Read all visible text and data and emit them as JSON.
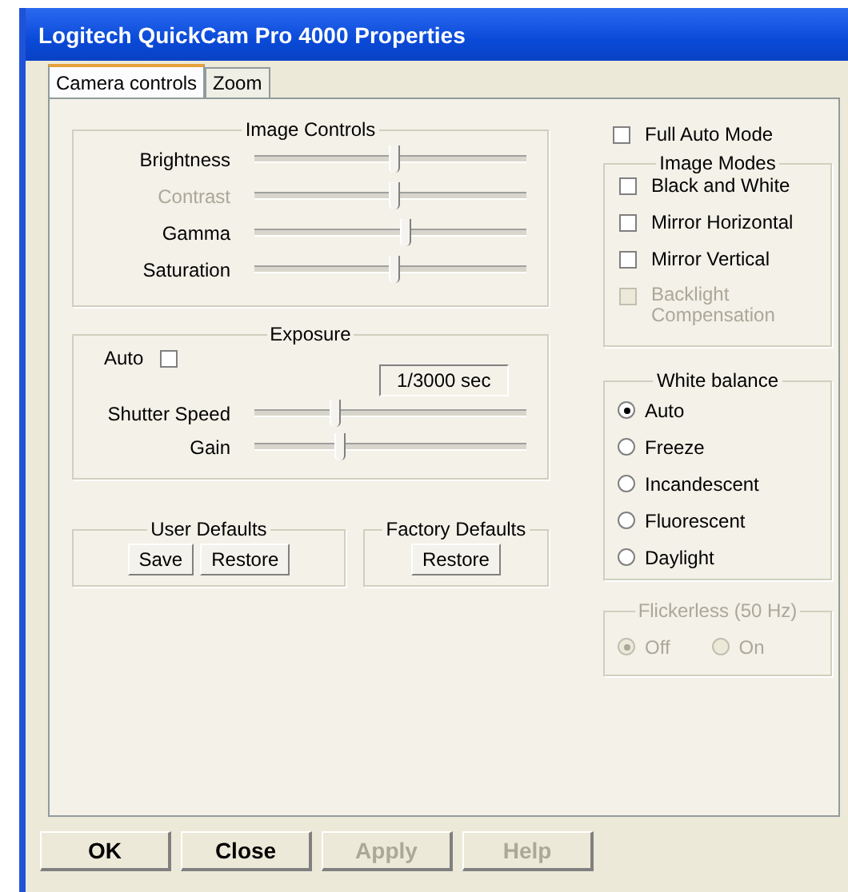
{
  "window": {
    "title": "Logitech QuickCam Pro 4000 Properties"
  },
  "tabs": [
    {
      "label": "Camera controls",
      "selected": true
    },
    {
      "label": "Zoom",
      "selected": false
    }
  ],
  "image_controls": {
    "title": "Image Controls",
    "sliders": [
      {
        "label": "Brightness",
        "disabled": false,
        "level": 0.52
      },
      {
        "label": "Contrast",
        "disabled": true,
        "level": 0.52
      },
      {
        "label": "Gamma",
        "disabled": false,
        "level": 0.56
      },
      {
        "label": "Saturation",
        "disabled": false,
        "level": 0.52
      }
    ]
  },
  "exposure": {
    "title": "Exposure",
    "auto": {
      "label": "Auto",
      "checked": false
    },
    "readout": "1/3000 sec",
    "sliders": [
      {
        "label": "Shutter Speed",
        "disabled": false,
        "level": 0.3
      },
      {
        "label": "Gain",
        "disabled": false,
        "level": 0.32
      }
    ]
  },
  "user_defaults": {
    "title": "User Defaults",
    "buttons": [
      "Save",
      "Restore"
    ]
  },
  "factory_defaults": {
    "title": "Factory Defaults",
    "buttons": [
      "Restore"
    ]
  },
  "full_auto_mode": {
    "label": "Full Auto Mode",
    "checked": false
  },
  "image_modes": {
    "title": "Image Modes",
    "options": [
      {
        "label": "Black and White",
        "checked": false,
        "disabled": false
      },
      {
        "label": "Mirror Horizontal",
        "checked": false,
        "disabled": false
      },
      {
        "label": "Mirror Vertical",
        "checked": false,
        "disabled": false
      },
      {
        "label": "Backlight Compensation",
        "checked": false,
        "disabled": true
      }
    ]
  },
  "white_balance": {
    "title": "White balance",
    "options": [
      {
        "label": "Auto",
        "selected": true
      },
      {
        "label": "Freeze",
        "selected": false
      },
      {
        "label": "Incandescent",
        "selected": false
      },
      {
        "label": "Fluorescent",
        "selected": false
      },
      {
        "label": "Daylight",
        "selected": false
      }
    ]
  },
  "flickerless": {
    "title": "Flickerless (50 Hz)",
    "disabled": true,
    "options": [
      {
        "label": "Off",
        "selected": true
      },
      {
        "label": "On",
        "selected": false
      }
    ]
  },
  "buttons": [
    {
      "label": "OK",
      "disabled": false
    },
    {
      "label": "Close",
      "disabled": false
    },
    {
      "label": "Apply",
      "disabled": true
    },
    {
      "label": "Help",
      "disabled": true
    }
  ]
}
